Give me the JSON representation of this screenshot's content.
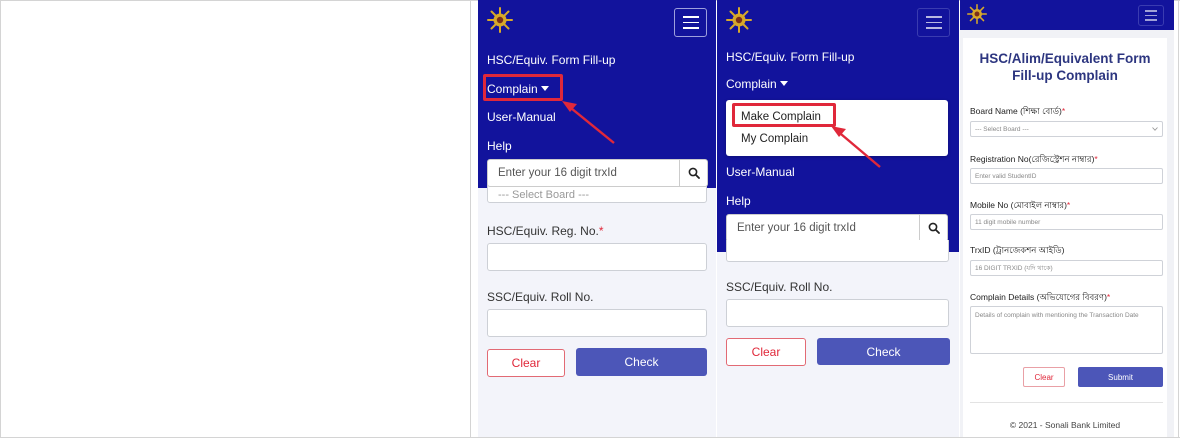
{
  "colors": {
    "navbar": "#12139c",
    "highlight": "#e0283a",
    "primary_button": "#4c56b8",
    "panel_background": "#f3f4fa",
    "card_title": "#2d3680"
  },
  "icons": {
    "logo": "sunburst-emblem-icon",
    "menu": "hamburger-menu-icon",
    "search": "magnifier-search-icon",
    "pointer": "red-arrow-icon"
  },
  "step1": {
    "nav_items": [
      "HSC/Equiv. Form Fill-up",
      "Complain",
      "User-Manual",
      "Help"
    ],
    "search_placeholder": "Enter your 16 digit trxId",
    "select_partial": "--- Select Board ---",
    "reg_label": "HSC/Equiv. Reg. No.",
    "required_mark": "*",
    "roll_label": "SSC/Equiv. Roll No.",
    "clear_label": "Clear",
    "check_label": "Check"
  },
  "step2": {
    "nav_items": [
      "HSC/Equiv. Form Fill-up",
      "Complain",
      "User-Manual",
      "Help"
    ],
    "dropdown_items": [
      "Make Complain",
      "My Complain"
    ],
    "search_placeholder": "Enter your 16 digit trxId",
    "roll_label": "SSC/Equiv. Roll No.",
    "clear_label": "Clear",
    "check_label": "Check"
  },
  "step3": {
    "title": "HSC/Alim/Equivalent Form Fill-up Complain",
    "required_mark": "*",
    "fields": [
      {
        "label": "Board Name (শিক্ষা বোর্ড)",
        "placeholder": "--- Select Board ---"
      },
      {
        "label": "Registration No(রেজিস্ট্রেশন নাম্বার)",
        "placeholder": "Enter valid StudentID"
      },
      {
        "label": "Mobile No (মোবাইল নাম্বার)",
        "placeholder": "11 digit mobile number"
      },
      {
        "label": "TrxID (ট্রানজেকশন আইডি)",
        "placeholder": "16 DIGIT TRXID (যদি থাকে)"
      },
      {
        "label": "Complain Details (অভিযোগের বিবরণ)",
        "placeholder": "Details of complain with mentioning the Transaction Date"
      }
    ],
    "clear_label": "Clear",
    "submit_label": "Submit",
    "footer": "© 2021 - Sonali Bank Limited"
  }
}
